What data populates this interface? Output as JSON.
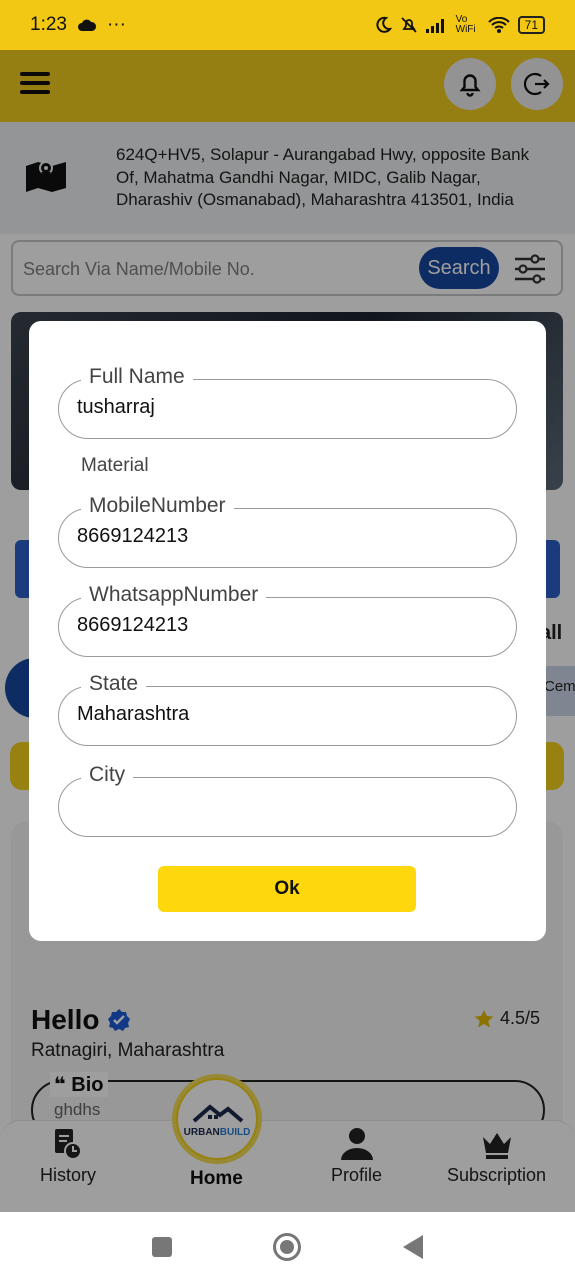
{
  "status_bar": {
    "time": "1:23",
    "dots": "···",
    "network": "Vo WiFi",
    "battery": "71"
  },
  "location": {
    "address": "624Q+HV5, Solapur - Aurangabad Hwy, opposite Bank Of, Mahatma Gandhi Nagar, MIDC, Galib Nagar, Dharashiv (Osmanabad), Maharashtra 413501, India"
  },
  "search": {
    "placeholder": "Search Via Name/Mobile No.",
    "button_label": "Search"
  },
  "background": {
    "all_text": "all",
    "cem_text": "Cem",
    "profile_name": "Hello",
    "rating": "4.5/5",
    "location": "Ratnagiri, Maharashtra",
    "bio_label": "Bio",
    "bio_value": "ghdhs"
  },
  "bottom_nav": {
    "history": "History",
    "home": "Home",
    "profile": "Profile",
    "subscription": "Subscription",
    "logo_text_1": "URBAN",
    "logo_text_2": "BUILD"
  },
  "dialog": {
    "full_name": {
      "label": "Full Name",
      "value": "tusharraj"
    },
    "section_label": "Material",
    "mobile": {
      "label": "MobileNumber",
      "value": "8669124213"
    },
    "whatsapp": {
      "label": "WhatsappNumber",
      "value": "8669124213"
    },
    "state": {
      "label": "State",
      "value": "Maharashtra"
    },
    "city": {
      "label": "City",
      "value": ""
    },
    "ok_label": "Ok"
  },
  "colors": {
    "accent_yellow": "#f3c814",
    "brand_blue": "#1447a0",
    "ok_yellow": "#fed80c"
  }
}
